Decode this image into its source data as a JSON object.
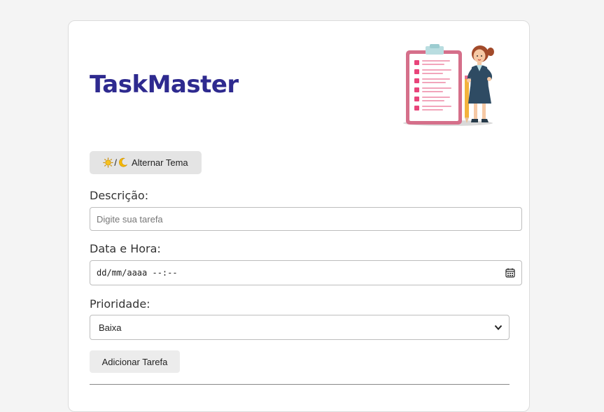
{
  "app": {
    "title": "TaskMaster"
  },
  "theme_toggle": {
    "label": "Alternar Tema",
    "separator": "/",
    "icons": [
      "sun-icon",
      "moon-icon"
    ]
  },
  "form": {
    "description": {
      "label": "Descrição:",
      "placeholder": "Digite sua tarefa",
      "value": ""
    },
    "datetime": {
      "label": "Data e Hora:",
      "display": "dd/mm/aaaa --:--",
      "icon": "calendar-icon"
    },
    "priority": {
      "label": "Prioridade:",
      "selected": "Baixa",
      "icon": "chevron-down-icon"
    },
    "submit_label": "Adicionar Tarefa"
  },
  "colors": {
    "brand": "#2e2a8f",
    "page_background": "#f4f4f4",
    "card_background": "#ffffff",
    "button_background": "#e4e4e4"
  }
}
